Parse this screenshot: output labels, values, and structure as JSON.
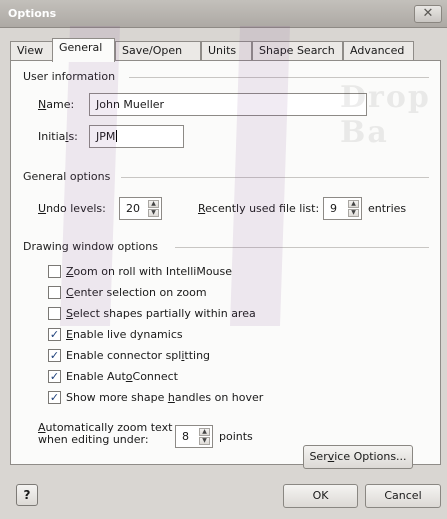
{
  "window": {
    "title": "Options",
    "close_glyph": "✕"
  },
  "watermark": {
    "text": "Drop Ba"
  },
  "tabs": [
    {
      "label": "View"
    },
    {
      "label": "General"
    },
    {
      "label": "Save/Open"
    },
    {
      "label": "Units"
    },
    {
      "label": "Shape Search"
    },
    {
      "label": "Advanced"
    }
  ],
  "user_info": {
    "heading": "User information",
    "name_label_a": "N",
    "name_label_b": "ame:",
    "name_value": "John Mueller",
    "initials_label_a": "Initia",
    "initials_label_b": "l",
    "initials_label_c": "s:",
    "initials_value": "JPM"
  },
  "general": {
    "heading": "General options",
    "undo_label_a": "U",
    "undo_label_b": "ndo levels:",
    "undo_value": "20",
    "recent_label_a": "R",
    "recent_label_b": "ecently used file list:",
    "recent_value": "9",
    "entries_label": "entries"
  },
  "drawing": {
    "heading": "Drawing window options",
    "options": [
      {
        "pre": "",
        "u": "Z",
        "post": "oom on roll with IntelliMouse",
        "checked": false
      },
      {
        "pre": "",
        "u": "C",
        "post": "enter selection on zoom",
        "checked": false
      },
      {
        "pre": "",
        "u": "S",
        "post": "elect shapes partially within area",
        "checked": false
      },
      {
        "pre": "",
        "u": "E",
        "post": "nable live dynamics",
        "checked": true
      },
      {
        "pre": "Enable connector spl",
        "u": "i",
        "post": "tting",
        "checked": true
      },
      {
        "pre": "Enable Aut",
        "u": "o",
        "post": "Connect",
        "checked": true
      },
      {
        "pre": "Show more shape ",
        "u": "h",
        "post": "andles on hover",
        "checked": true
      }
    ],
    "zoom_text_line1_a": "A",
    "zoom_text_line1_b": "utomatically zoom text",
    "zoom_text_line2": "when editing under:",
    "zoom_value": "8",
    "points_label": "points",
    "service_a": "Ser",
    "service_b": "v",
    "service_c": "ice Options..."
  },
  "footer": {
    "help_glyph": "?",
    "ok_label": "OK",
    "cancel_label": "Cancel"
  },
  "icons": {
    "check": "✓",
    "spin_up": "▲",
    "spin_down": "▼"
  }
}
